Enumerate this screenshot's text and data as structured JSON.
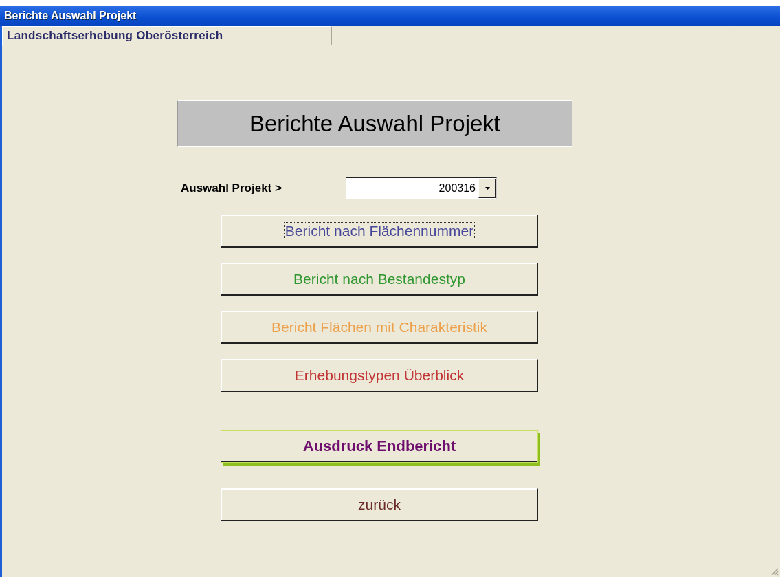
{
  "window": {
    "title": "Berichte Auswahl Projekt"
  },
  "subtitle": "Landschaftserhebung Oberösterreich",
  "heading": "Berichte Auswahl Projekt",
  "project_select": {
    "label": "Auswahl Projekt >",
    "value": "200316"
  },
  "buttons": [
    {
      "label": "Bericht nach Flächennummer",
      "color": "#48489a",
      "kind": "focused"
    },
    {
      "label": "Bericht nach Bestandestyp",
      "color": "#2f962f",
      "kind": "plain"
    },
    {
      "label": "Bericht Flächen mit Charakteristik",
      "color": "#eca04a",
      "kind": "plain"
    },
    {
      "label": "Erhebungstypen Überblick",
      "color": "#c23535",
      "kind": "plain"
    },
    {
      "label": "Ausdruck Endbericht",
      "color": "#6e0f6e",
      "kind": "accent"
    },
    {
      "label": "zurück",
      "color": "#6a2a2a",
      "kind": "plain"
    }
  ]
}
